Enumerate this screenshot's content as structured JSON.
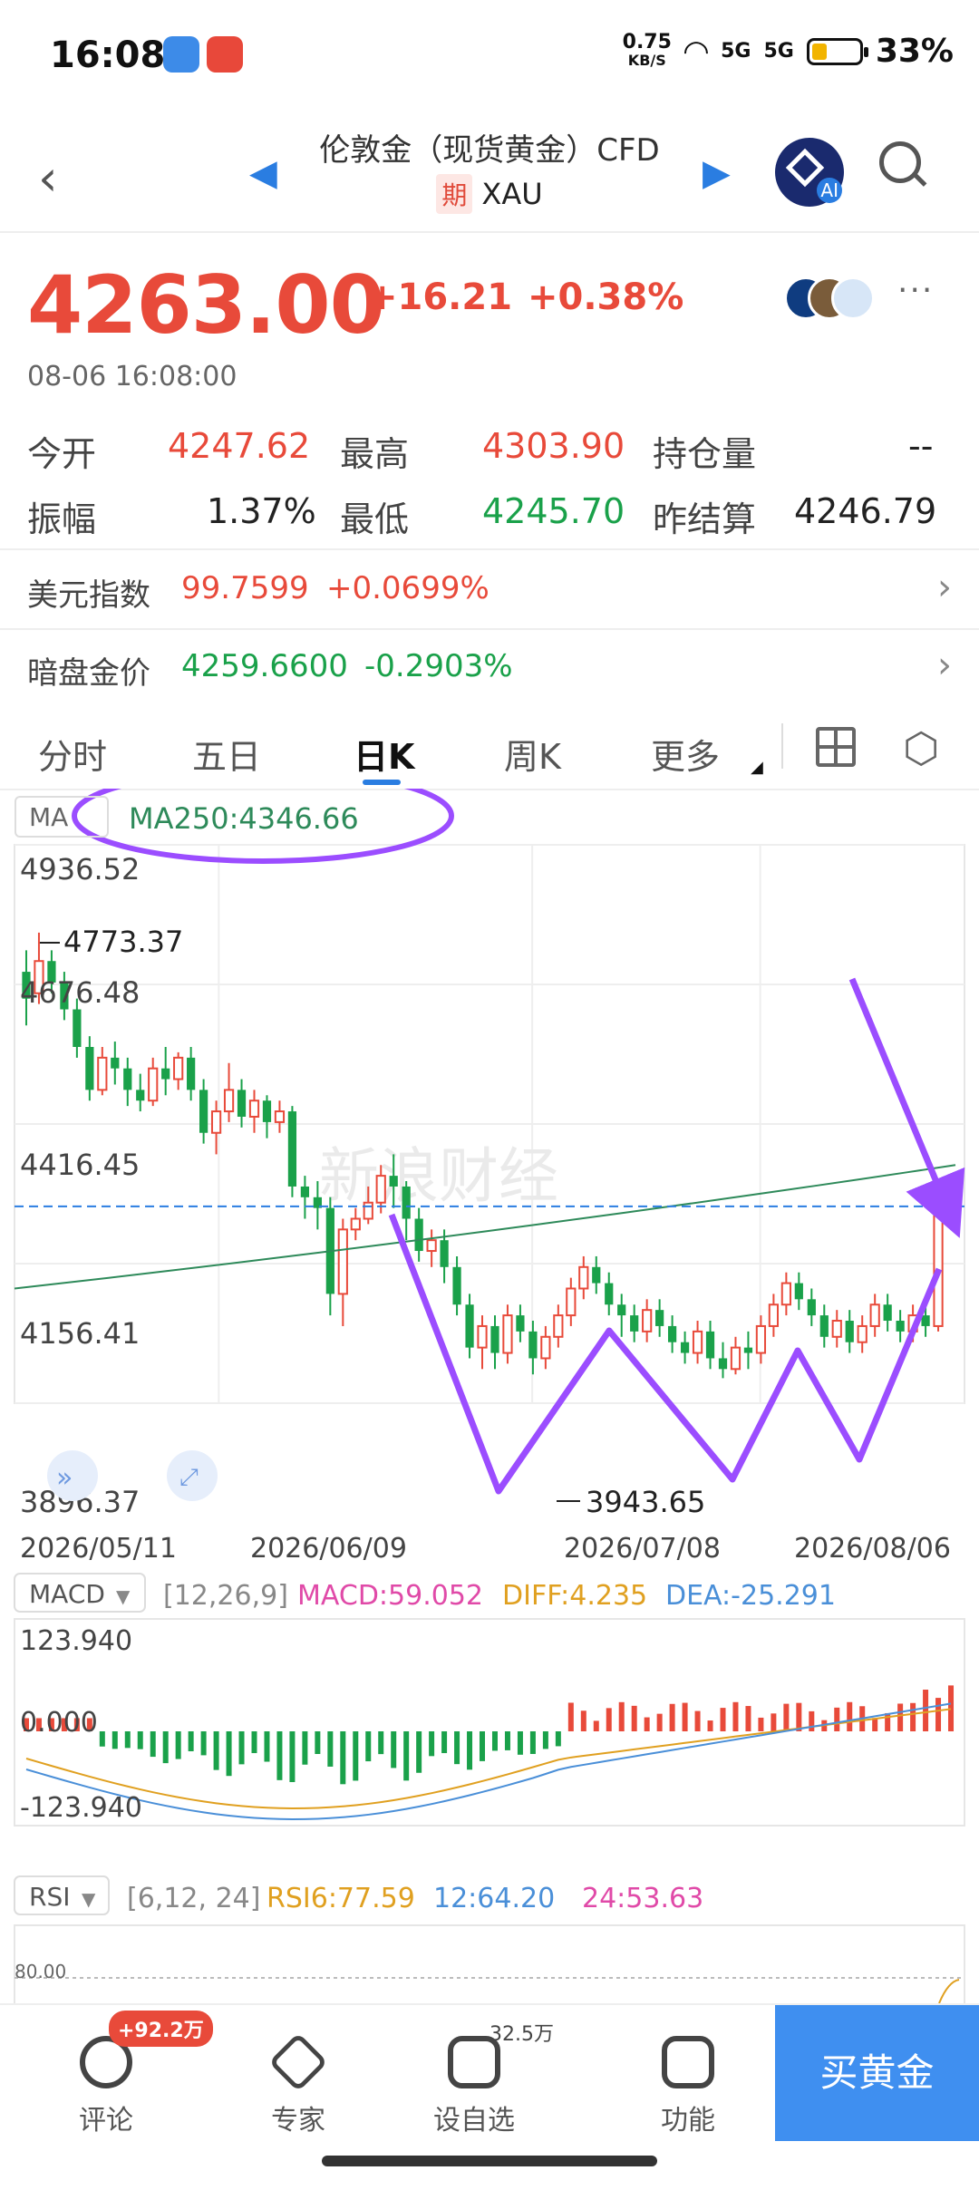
{
  "status_bar": {
    "time": "16:08",
    "net_speed_value": "0.75",
    "net_speed_unit": "KB/S",
    "signal1": "5G",
    "signal2": "5G",
    "battery": "33%"
  },
  "header": {
    "title": "伦敦金（现货黄金）CFD",
    "tag": "期",
    "symbol": "XAU",
    "ai_label": "AI"
  },
  "quote": {
    "price": "4263.00",
    "change": "+16.21",
    "change_pct": "+0.38%",
    "timestamp": "08-06 16:08:00",
    "more": "···"
  },
  "stats": [
    {
      "label": "今开",
      "value": "4247.62",
      "color": "#e84a3a"
    },
    {
      "label": "最高",
      "value": "4303.90",
      "color": "#e84a3a"
    },
    {
      "label": "持仓量",
      "value": "--",
      "color": "#222222"
    },
    {
      "label": "振幅",
      "value": "1.37%",
      "color": "#222222"
    },
    {
      "label": "最低",
      "value": "4245.70",
      "color": "#1aa14a"
    },
    {
      "label": "昨结算",
      "value": "4246.79",
      "color": "#222222"
    }
  ],
  "related": [
    {
      "name": "美元指数",
      "value": "99.7599",
      "change": "+0.0699%",
      "color": "#e84a3a"
    },
    {
      "name": "暗盘金价",
      "value": "4259.6600",
      "change": "-0.2903%",
      "color": "#1aa14a"
    }
  ],
  "tabs": [
    "分时",
    "五日",
    "日K",
    "周K",
    "更多"
  ],
  "chart": {
    "ma_selector": "MA",
    "ma_label": "MA250:4346.66",
    "watermark": "新浪财经",
    "y_ticks": [
      "4936.52",
      "4676.48",
      "4416.45",
      "4156.41",
      "3896.37"
    ],
    "high_label": "4773.37",
    "low_label": "3943.65",
    "x_ticks": [
      "2026/05/11",
      "2026/06/09",
      "2026/07/08",
      "2026/08/06"
    ]
  },
  "chart_data": [
    {
      "type": "candlestick",
      "title": "日K",
      "ylim": [
        3896.37,
        4936.52
      ],
      "yticks": [
        4936.52,
        4676.48,
        4416.45,
        4156.41,
        3896.37
      ],
      "xticks": [
        "2026/05/11",
        "2026/06/09",
        "2026/07/08",
        "2026/08/06"
      ],
      "annotations": {
        "high": 4773.37,
        "low": 3943.65,
        "last": 4263.0
      },
      "ma250": {
        "last": 4346.66,
        "start": 4110,
        "end": 4340
      },
      "candles": [
        [
          4700,
          4650,
          4740,
          4600
        ],
        [
          4660,
          4720,
          4773,
          4640
        ],
        [
          4720,
          4680,
          4740,
          4660
        ],
        [
          4680,
          4630,
          4700,
          4610
        ],
        [
          4630,
          4560,
          4650,
          4540
        ],
        [
          4560,
          4480,
          4580,
          4460
        ],
        [
          4480,
          4540,
          4560,
          4470
        ],
        [
          4540,
          4520,
          4570,
          4490
        ],
        [
          4520,
          4480,
          4540,
          4450
        ],
        [
          4480,
          4460,
          4510,
          4440
        ],
        [
          4460,
          4520,
          4540,
          4450
        ],
        [
          4520,
          4500,
          4560,
          4470
        ],
        [
          4500,
          4540,
          4550,
          4480
        ],
        [
          4540,
          4480,
          4560,
          4460
        ],
        [
          4480,
          4400,
          4500,
          4380
        ],
        [
          4400,
          4440,
          4460,
          4360
        ],
        [
          4440,
          4480,
          4530,
          4420
        ],
        [
          4480,
          4430,
          4500,
          4410
        ],
        [
          4430,
          4460,
          4480,
          4400
        ],
        [
          4460,
          4420,
          4470,
          4390
        ],
        [
          4420,
          4440,
          4460,
          4400
        ],
        [
          4440,
          4300,
          4450,
          4280
        ],
        [
          4300,
          4280,
          4320,
          4240
        ],
        [
          4280,
          4260,
          4310,
          4220
        ],
        [
          4260,
          4100,
          4280,
          4060
        ],
        [
          4100,
          4220,
          4240,
          4040
        ],
        [
          4220,
          4240,
          4260,
          4200
        ],
        [
          4240,
          4270,
          4300,
          4230
        ],
        [
          4270,
          4320,
          4340,
          4250
        ],
        [
          4320,
          4300,
          4360,
          4260
        ],
        [
          4300,
          4240,
          4310,
          4200
        ],
        [
          4240,
          4180,
          4260,
          4160
        ],
        [
          4180,
          4200,
          4220,
          4150
        ],
        [
          4200,
          4150,
          4220,
          4120
        ],
        [
          4150,
          4080,
          4170,
          4060
        ],
        [
          4080,
          4000,
          4100,
          3980
        ],
        [
          4000,
          4040,
          4060,
          3960
        ],
        [
          4040,
          3990,
          4060,
          3960
        ],
        [
          3990,
          4060,
          4080,
          3970
        ],
        [
          4060,
          4030,
          4080,
          4010
        ],
        [
          4030,
          3980,
          4050,
          3950
        ],
        [
          3980,
          4020,
          4040,
          3960
        ],
        [
          4020,
          4060,
          4080,
          4000
        ],
        [
          4060,
          4110,
          4130,
          4040
        ],
        [
          4110,
          4150,
          4170,
          4090
        ],
        [
          4150,
          4120,
          4170,
          4100
        ],
        [
          4120,
          4080,
          4140,
          4060
        ],
        [
          4080,
          4060,
          4100,
          4020
        ],
        [
          4060,
          4030,
          4080,
          4010
        ],
        [
          4030,
          4070,
          4090,
          4010
        ],
        [
          4070,
          4040,
          4090,
          4020
        ],
        [
          4040,
          4010,
          4060,
          3990
        ],
        [
          4010,
          3990,
          4030,
          3970
        ],
        [
          3990,
          4030,
          4050,
          3970
        ],
        [
          4030,
          3980,
          4050,
          3960
        ],
        [
          3980,
          3960,
          4010,
          3943
        ],
        [
          3960,
          4000,
          4020,
          3950
        ],
        [
          4000,
          3990,
          4030,
          3960
        ],
        [
          3990,
          4040,
          4060,
          3970
        ],
        [
          4040,
          4080,
          4100,
          4020
        ],
        [
          4080,
          4120,
          4140,
          4060
        ],
        [
          4120,
          4090,
          4140,
          4070
        ],
        [
          4090,
          4060,
          4110,
          4040
        ],
        [
          4060,
          4020,
          4080,
          4000
        ],
        [
          4020,
          4050,
          4070,
          4000
        ],
        [
          4050,
          4010,
          4070,
          3990
        ],
        [
          4010,
          4040,
          4060,
          3990
        ],
        [
          4040,
          4080,
          4100,
          4020
        ],
        [
          4080,
          4050,
          4100,
          4030
        ],
        [
          4050,
          4030,
          4070,
          4010
        ],
        [
          4030,
          4060,
          4080,
          4010
        ],
        [
          4060,
          4040,
          4080,
          4020
        ],
        [
          4040,
          4246,
          4260,
          4030
        ],
        [
          4247,
          4263,
          4303,
          4245
        ]
      ]
    },
    {
      "type": "bar+line",
      "title": "MACD",
      "params": "[12,26,9]",
      "ylim": [
        -123.94,
        123.94
      ],
      "yticks": [
        123.94,
        0.0,
        -123.94
      ],
      "series": [
        {
          "name": "MACD",
          "last": 59.052
        },
        {
          "name": "DIFF",
          "last": 4.235
        },
        {
          "name": "DEA",
          "last": -25.291
        }
      ]
    },
    {
      "type": "line",
      "title": "RSI",
      "params": "[6,12, 24]",
      "yticks": [
        80.0
      ],
      "series": [
        {
          "name": "RSI6",
          "last": 77.59
        },
        {
          "name": "12",
          "last": 64.2
        },
        {
          "name": "24",
          "last": 53.63
        }
      ]
    }
  ],
  "macd": {
    "selector": "MACD",
    "params": "[12,26,9]",
    "macd": "MACD:59.052",
    "diff": "DIFF:4.235",
    "dea": "DEA:-25.291",
    "y_top": "123.940",
    "y_mid": "0.000",
    "y_bottom": "-123.940"
  },
  "rsi": {
    "selector": "RSI",
    "params": "[6,12, 24]",
    "rsi6": "RSI6:77.59",
    "rsi12": "12:64.20",
    "rsi24": "24:53.63",
    "y_top": "80.00"
  },
  "bottom_nav": {
    "comment": "评论",
    "comment_badge": "+92.2万",
    "expert": "专家",
    "watch": "设自选",
    "watch_count": "32.5万",
    "function": "功能",
    "buy": "买黄金"
  },
  "colors": {
    "up": "#e84a3a",
    "down": "#1aa14a",
    "annotation": "#9b4dff",
    "accent": "#2a7de1"
  }
}
